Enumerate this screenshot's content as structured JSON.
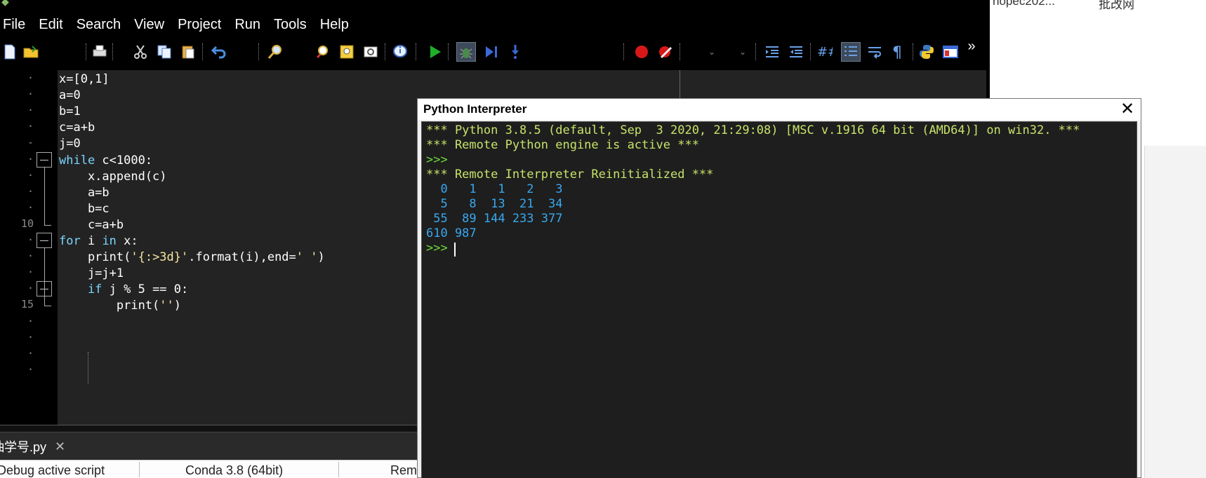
{
  "menu": [
    "File",
    "Edit",
    "Search",
    "View",
    "Project",
    "Run",
    "Tools",
    "Help"
  ],
  "toolbar": {
    "icons": [
      "new-file",
      "open-file",
      "print",
      "cut",
      "copy",
      "paste",
      "undo",
      "find",
      "find-in-files",
      "replace",
      "goto",
      "info",
      "run",
      "debug",
      "step",
      "breakpoint",
      "toggle-breakpoint",
      "clear-breakpoints",
      "indent",
      "dedent",
      "comment",
      "outline",
      "word-wrap",
      "whitespace",
      "python",
      "layout",
      "more"
    ]
  },
  "editor": {
    "line_numbers": [
      "·",
      "·",
      "·",
      "·",
      "-",
      "·",
      "·",
      "·",
      "·",
      "10",
      "·",
      "·",
      "·",
      "·",
      "15",
      "·",
      "·",
      "·",
      "·"
    ],
    "lines": [
      [
        {
          "t": "x=[0,1]",
          "c": "op"
        }
      ],
      [
        {
          "t": "a=0",
          "c": "op"
        }
      ],
      [
        {
          "t": "b=1",
          "c": "op"
        }
      ],
      [
        {
          "t": "c=a+b",
          "c": "op"
        }
      ],
      [
        {
          "t": "j=0",
          "c": "op"
        }
      ],
      [
        {
          "t": "while",
          "c": "kw"
        },
        {
          "t": " c<1000:",
          "c": "op"
        }
      ],
      [
        {
          "t": "    x.append(c)",
          "c": "op"
        }
      ],
      [
        {
          "t": "    a=b",
          "c": "op"
        }
      ],
      [
        {
          "t": "    b=c",
          "c": "op"
        }
      ],
      [
        {
          "t": "    c=a+b",
          "c": "op"
        }
      ],
      [
        {
          "t": "for",
          "c": "kw"
        },
        {
          "t": " i ",
          "c": "op"
        },
        {
          "t": "in",
          "c": "kw"
        },
        {
          "t": " x:",
          "c": "op"
        }
      ],
      [
        {
          "t": "    print(",
          "c": "op"
        },
        {
          "t": "'{:>3d}'",
          "c": "str"
        },
        {
          "t": ".format(i),end=",
          "c": "op"
        },
        {
          "t": "' '",
          "c": "str"
        },
        {
          "t": ")",
          "c": "op"
        }
      ],
      [
        {
          "t": "    j=j+1",
          "c": "op"
        }
      ],
      [
        {
          "t": "    if",
          "c": "kw"
        },
        {
          "t": " j % 5 == 0:",
          "c": "op"
        }
      ],
      [
        {
          "t": "        print(",
          "c": "op"
        },
        {
          "t": "''",
          "c": "str"
        },
        {
          "t": ")",
          "c": "op"
        }
      ]
    ]
  },
  "tab": {
    "label": "抽学号.py",
    "close": "✕"
  },
  "status": {
    "debug": "Debug active script",
    "env": "Conda 3.8 (64bit)",
    "remote": "Remo"
  },
  "interpreter": {
    "title": "Python Interpreter",
    "close": "✕",
    "lines": [
      {
        "text": "*** Python 3.8.5 (default, Sep  3 2020, 21:29:08) [MSC v.1916 64 bit (AMD64)] on win32. ***",
        "kind": "msg"
      },
      {
        "text": "*** Remote Python engine is active ***",
        "kind": "msg"
      },
      {
        "text": ">>>",
        "kind": "prompt"
      },
      {
        "text": "*** Remote Interpreter Reinitialized ***",
        "kind": "msg"
      },
      {
        "text": "  0   1   1   2   3",
        "kind": "out"
      },
      {
        "text": "  5   8  13  21  34",
        "kind": "out"
      },
      {
        "text": " 55  89 144 233 377",
        "kind": "out"
      },
      {
        "text": "610 987",
        "kind": "out"
      },
      {
        "text": ">>> ",
        "kind": "prompt"
      }
    ]
  },
  "background": {
    "frag1": "hopec202...",
    "frag2": "批改网"
  }
}
